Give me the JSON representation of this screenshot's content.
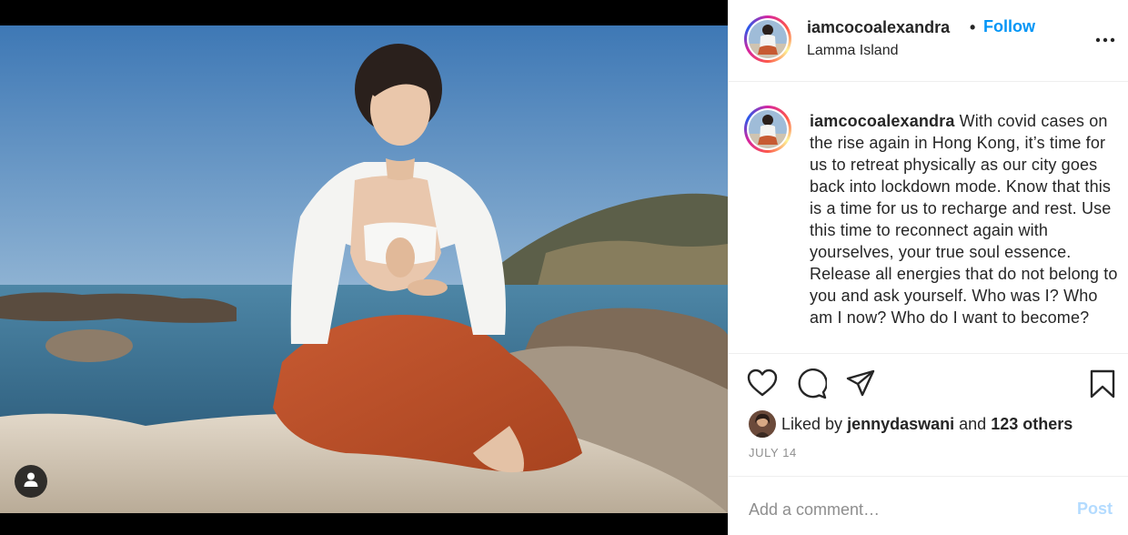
{
  "post": {
    "username": "iamcocoalexandra",
    "separator": "•",
    "follow_label": "Follow",
    "location": "Lamma Island",
    "more_icon": "more-options-icon"
  },
  "caption": {
    "username": "iamcocoalexandra",
    "text": "With covid cases on the rise again in Hong Kong, it’s time for us to retreat physically as our city goes back into lockdown mode. Know that this is a time for us to recharge and rest. Use this time to reconnect again with yourselves, your true soul essence. Release all energies that do not belong to you and ask yourself. Who was I? Who am I now? Who do I want to become?"
  },
  "actions": {
    "like_icon": "heart-icon",
    "comment_icon": "comment-icon",
    "share_icon": "share-icon",
    "save_icon": "bookmark-icon"
  },
  "likes": {
    "prefix": "Liked by",
    "user": "jennydaswani",
    "conjunction": "and",
    "others": "123 others"
  },
  "date": "JULY 14",
  "comment": {
    "placeholder": "Add a comment…",
    "post_label": "Post"
  },
  "colors": {
    "accent": "#0095f6",
    "post_disabled": "#b3dbff",
    "muted": "#8e8e8e"
  }
}
